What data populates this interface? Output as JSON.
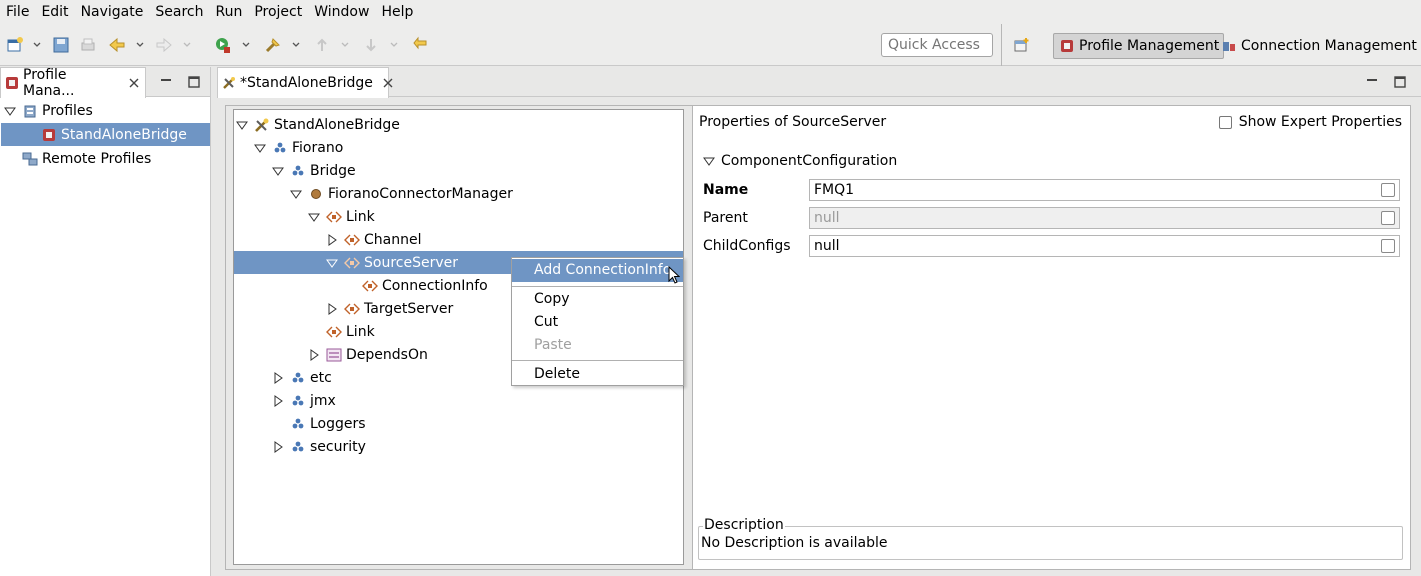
{
  "menubar": {
    "items": [
      "File",
      "Edit",
      "Navigate",
      "Search",
      "Run",
      "Project",
      "Window",
      "Help"
    ]
  },
  "toolbar": {
    "quick_access_placeholder": "Quick Access",
    "perspectives": {
      "profile_management": "Profile Management",
      "connection_management": "Connection Management"
    }
  },
  "left_view": {
    "tab_label": "Profile Mana...",
    "tree": {
      "profiles": "Profiles",
      "standalone_bridge": "StandAloneBridge",
      "remote_profiles": "Remote Profiles"
    }
  },
  "editor": {
    "tab_label": "*StandAloneBridge",
    "tree": {
      "root": "StandAloneBridge",
      "fiorano": "Fiorano",
      "bridge": "Bridge",
      "connector_manager": "FioranoConnectorManager",
      "link1": "Link",
      "channel": "Channel",
      "source_server": "SourceServer",
      "connection_info": "ConnectionInfo",
      "target_server": "TargetServer",
      "link2": "Link",
      "depends_on": "DependsOn",
      "etc": "etc",
      "jmx": "jmx",
      "loggers": "Loggers",
      "security": "security"
    },
    "properties": {
      "header": "Properties of SourceServer",
      "show_expert": "Show Expert Properties",
      "section": "ComponentConfiguration",
      "name_label": "Name",
      "name_value": "FMQ1",
      "parent_label": "Parent",
      "parent_value": "null",
      "childconfigs_label": "ChildConfigs",
      "childconfigs_value": "null",
      "description_label": "Description",
      "description_value": "No Description is available"
    }
  },
  "context_menu": {
    "add_connection_info": "Add ConnectionInfo",
    "copy": "Copy",
    "cut": "Cut",
    "paste": "Paste",
    "delete": "Delete"
  },
  "colors": {
    "selection": "#6f95c4",
    "panel_bg": "#e8e8e7"
  }
}
